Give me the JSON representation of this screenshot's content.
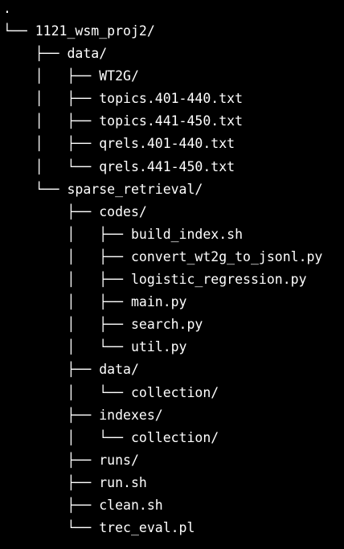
{
  "tree": {
    "lines": [
      {
        "prefix": "",
        "name": "."
      },
      {
        "prefix": "└── ",
        "name": "1121_wsm_proj2/"
      },
      {
        "prefix": "    ├── ",
        "name": "data/"
      },
      {
        "prefix": "    │   ├── ",
        "name": "WT2G/"
      },
      {
        "prefix": "    │   ├── ",
        "name": "topics.401-440.txt"
      },
      {
        "prefix": "    │   ├── ",
        "name": "topics.441-450.txt"
      },
      {
        "prefix": "    │   ├── ",
        "name": "qrels.401-440.txt"
      },
      {
        "prefix": "    │   └── ",
        "name": "qrels.441-450.txt"
      },
      {
        "prefix": "    └── ",
        "name": "sparse_retrieval/"
      },
      {
        "prefix": "        ├── ",
        "name": "codes/"
      },
      {
        "prefix": "        │   ├── ",
        "name": "build_index.sh"
      },
      {
        "prefix": "        │   ├── ",
        "name": "convert_wt2g_to_jsonl.py"
      },
      {
        "prefix": "        │   ├── ",
        "name": "logistic_regression.py"
      },
      {
        "prefix": "        │   ├── ",
        "name": "main.py"
      },
      {
        "prefix": "        │   ├── ",
        "name": "search.py"
      },
      {
        "prefix": "        │   └── ",
        "name": "util.py"
      },
      {
        "prefix": "        ├── ",
        "name": "data/"
      },
      {
        "prefix": "        │   └── ",
        "name": "collection/"
      },
      {
        "prefix": "        ├── ",
        "name": "indexes/"
      },
      {
        "prefix": "        │   └── ",
        "name": "collection/"
      },
      {
        "prefix": "        ├── ",
        "name": "runs/"
      },
      {
        "prefix": "        ├── ",
        "name": "run.sh"
      },
      {
        "prefix": "        ├── ",
        "name": "clean.sh"
      },
      {
        "prefix": "        └── ",
        "name": "trec_eval.pl"
      }
    ]
  }
}
